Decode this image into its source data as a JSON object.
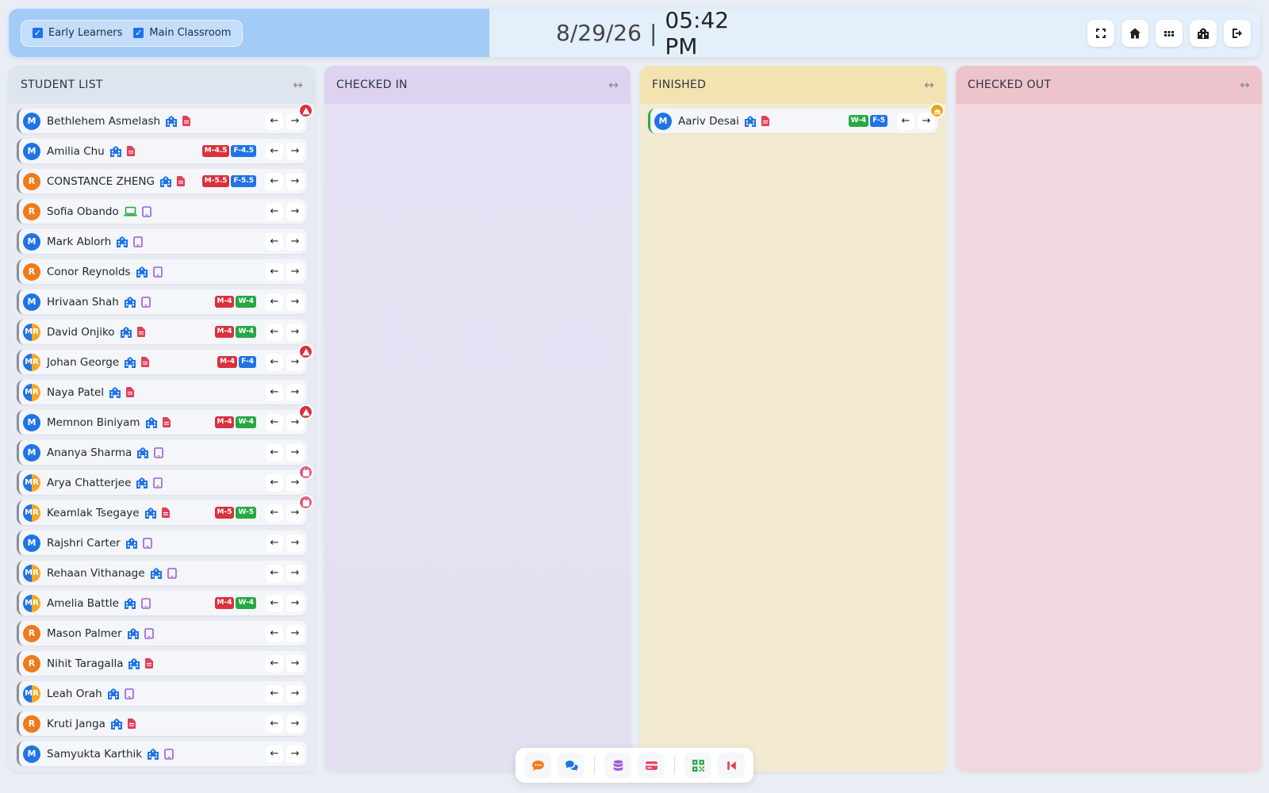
{
  "header": {
    "filters": [
      {
        "label": "Early Learners",
        "checked": true
      },
      {
        "label": "Main Classroom",
        "checked": true
      }
    ],
    "date": "8/29/26",
    "separator": "|",
    "time": "05:42 PM",
    "actions": [
      "fullscreen-icon",
      "home-icon",
      "apps-grid-icon",
      "school-icon",
      "logout-icon"
    ]
  },
  "columns": {
    "student_list": {
      "title": "STUDENT LIST"
    },
    "checked_in": {
      "title": "CHECKED IN"
    },
    "finished": {
      "title": "FINISHED"
    },
    "checked_out": {
      "title": "CHECKED OUT"
    }
  },
  "students": [
    {
      "avatar": "M",
      "name": "Bethlehem Asmelash",
      "icons": [
        "school",
        "file"
      ],
      "badges": [],
      "alert": "warning"
    },
    {
      "avatar": "M",
      "name": "Amilia Chu",
      "icons": [
        "school",
        "file"
      ],
      "badges": [
        "M-4.5",
        "F-4.5"
      ],
      "alert": null
    },
    {
      "avatar": "R",
      "name": "CONSTANCE ZHENG",
      "icons": [
        "school",
        "file"
      ],
      "badges": [
        "M-5.5",
        "F-5.5"
      ],
      "alert": null
    },
    {
      "avatar": "R",
      "name": "Sofia Obando",
      "icons": [
        "laptop",
        "tablet"
      ],
      "badges": [],
      "alert": null
    },
    {
      "avatar": "M",
      "name": "Mark Ablorh",
      "icons": [
        "school",
        "tablet"
      ],
      "badges": [],
      "alert": null
    },
    {
      "avatar": "R",
      "name": "Conor Reynolds",
      "icons": [
        "school",
        "tablet"
      ],
      "badges": [],
      "alert": null
    },
    {
      "avatar": "M",
      "name": "Hrivaan Shah",
      "icons": [
        "school",
        "tablet"
      ],
      "badges": [
        "M-4",
        "W-4"
      ],
      "alert": null
    },
    {
      "avatar": "MR",
      "name": "David Onjiko",
      "icons": [
        "school",
        "file"
      ],
      "badges": [
        "M-4",
        "W-4"
      ],
      "alert": null
    },
    {
      "avatar": "MR",
      "name": "Johan George",
      "icons": [
        "school",
        "file"
      ],
      "badges": [
        "M-4",
        "F-4"
      ],
      "alert": "warning"
    },
    {
      "avatar": "MR",
      "name": "Naya Patel",
      "icons": [
        "school",
        "file"
      ],
      "badges": [],
      "alert": null
    },
    {
      "avatar": "M",
      "name": "Memnon Biniyam",
      "icons": [
        "school",
        "file"
      ],
      "badges": [
        "M-4",
        "W-4"
      ],
      "alert": "warning"
    },
    {
      "avatar": "M",
      "name": "Ananya Sharma",
      "icons": [
        "school",
        "tablet"
      ],
      "badges": [],
      "alert": null
    },
    {
      "avatar": "MR",
      "name": "Arya Chatterjee",
      "icons": [
        "school",
        "tablet"
      ],
      "badges": [],
      "alert": "calendar"
    },
    {
      "avatar": "MR",
      "name": "Keamlak Tsegaye",
      "icons": [
        "school",
        "file"
      ],
      "badges": [
        "M-5",
        "W-5"
      ],
      "alert": "calendar"
    },
    {
      "avatar": "M",
      "name": "Rajshri Carter",
      "icons": [
        "school",
        "tablet"
      ],
      "badges": [],
      "alert": null
    },
    {
      "avatar": "MR",
      "name": "Rehaan Vithanage",
      "icons": [
        "school",
        "tablet"
      ],
      "badges": [],
      "alert": null
    },
    {
      "avatar": "MR",
      "name": "Amelia Battle",
      "icons": [
        "school",
        "tablet"
      ],
      "badges": [
        "M-4",
        "W-4"
      ],
      "alert": null
    },
    {
      "avatar": "R",
      "name": "Mason Palmer",
      "icons": [
        "school",
        "tablet"
      ],
      "badges": [],
      "alert": null
    },
    {
      "avatar": "R",
      "name": "Nihit Taragalla",
      "icons": [
        "school",
        "file"
      ],
      "badges": [],
      "alert": null
    },
    {
      "avatar": "MR",
      "name": "Leah Orah",
      "icons": [
        "school",
        "tablet"
      ],
      "badges": [],
      "alert": null
    },
    {
      "avatar": "R",
      "name": "Kruti Janga",
      "icons": [
        "school",
        "file"
      ],
      "badges": [],
      "alert": null
    },
    {
      "avatar": "M",
      "name": "Samyukta Karthik",
      "icons": [
        "school",
        "tablet"
      ],
      "badges": [],
      "alert": null
    }
  ],
  "finished_students": [
    {
      "avatar": "M",
      "name": "Aariv Desai",
      "icons": [
        "school",
        "file"
      ],
      "badges": [
        "W-4",
        "F-5"
      ],
      "alert": "sun"
    }
  ],
  "toolbar": [
    "chat-icon",
    "comments-icon",
    "database-icon",
    "card-icon",
    "qr-code-icon",
    "skip-back-icon"
  ],
  "colors": {
    "accent": "#1f74e6",
    "avatar_m": "#1f74e6",
    "avatar_r": "#f07b1a",
    "badge_m": "#d9313d",
    "badge_f": "#1f74e6",
    "badge_w": "#27a844"
  }
}
